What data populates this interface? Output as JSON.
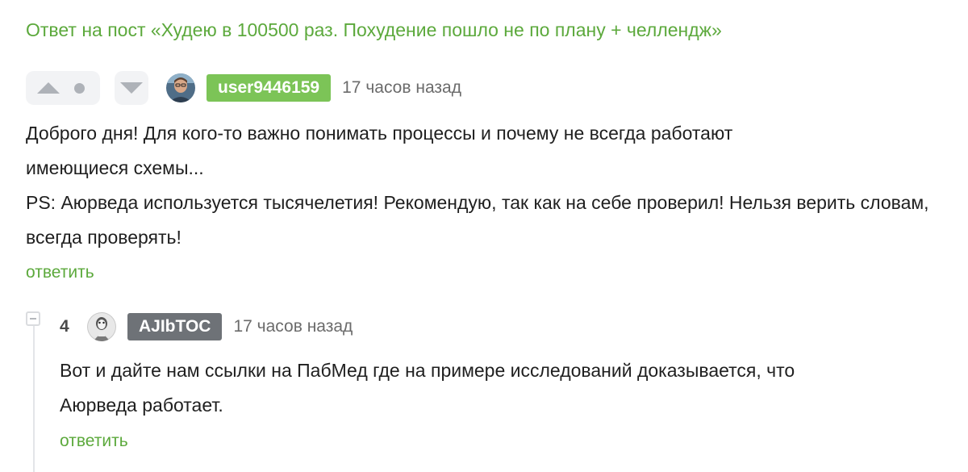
{
  "post_link": "Ответ на пост «Худею в 100500 раз. Похудение пошло не по плану + челлендж»",
  "comment": {
    "username": "user9446159",
    "time": "17 часов назад",
    "paragraph1": "Доброго дня! Для кого-то важно понимать процессы и почему не всегда работают имеющиеся схемы...",
    "paragraph2": "PS: Аюрведа используется тысячелетия! Рекомендую, так как на себе проверил! Нельзя верить словам, всегда проверять!",
    "reply_label": "ответить"
  },
  "reply": {
    "rating": "4",
    "username": "AJIbTOC",
    "time": "17 часов назад",
    "text": "Вот и дайте нам ссылки на ПабМед где на примере исследований доказывается, что Аюрведа работает.",
    "reply_label": "ответить"
  },
  "colors": {
    "accent_green": "#5ca93c",
    "badge_green": "#7cc457",
    "badge_gray": "#6e7277",
    "vote_icon": "#aeb2b8"
  },
  "icons": {
    "upvote": "triangle-up-icon",
    "neutral": "dot-icon",
    "downvote": "triangle-down-icon",
    "collapse": "minus-square-icon"
  }
}
